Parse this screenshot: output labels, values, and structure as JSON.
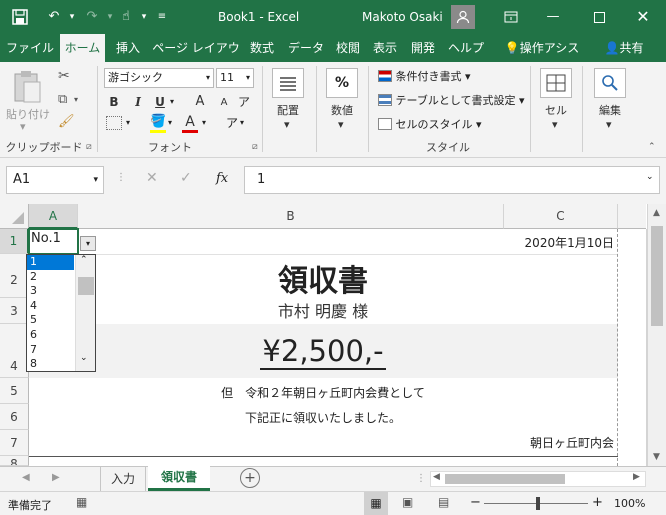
{
  "title_bar": {
    "doc_title": "Book1 - Excel",
    "user_name": "Makoto Osaki",
    "qat": {
      "save": "save-icon",
      "undo": "undo-icon",
      "redo": "redo-icon",
      "touch": "touch-icon",
      "customize": "customize-icon"
    }
  },
  "tabs": [
    "ファイル",
    "ホーム",
    "挿入",
    "ページ レイアウト",
    "数式",
    "データ",
    "校閲",
    "表示",
    "開発",
    "ヘルプ"
  ],
  "tell_me": "操作アシス",
  "share": "共有",
  "ribbon": {
    "clipboard": {
      "paste": "貼り付け",
      "label": "クリップボード"
    },
    "font": {
      "font_name": "游ゴシック",
      "font_size": "11",
      "bold": "B",
      "italic": "I",
      "underline": "U",
      "grow": "A",
      "shrink": "A",
      "font_color": "A",
      "label": "フォント"
    },
    "alignment": {
      "label": "配置"
    },
    "number": {
      "label": "数値",
      "percent": "%"
    },
    "styles": {
      "cond": "条件付き書式",
      "table": "テーブルとして書式設定",
      "cell_style": "セルのスタイル",
      "label": "スタイル"
    },
    "cells": {
      "label": "セル"
    },
    "editing": {
      "label": "編集"
    }
  },
  "formula_bar": {
    "name_box": "A1",
    "fx": "fx",
    "value": "1"
  },
  "columns": [
    "A",
    "B",
    "C"
  ],
  "rows": [
    "1",
    "2",
    "3",
    "4",
    "5",
    "6",
    "7",
    "8"
  ],
  "cells": {
    "a1": "No.1",
    "c1": "2020年1月10日",
    "b2": "領収書",
    "b3": "市村 明慶 様",
    "b4": "¥2,500,-",
    "b5": "但　令和２年朝日ヶ丘町内会費として",
    "b6": "下記正に領収いたしました。",
    "c7": "朝日ヶ丘町内会"
  },
  "dropdown": {
    "items": [
      "1",
      "2",
      "3",
      "4",
      "5",
      "6",
      "7",
      "8"
    ],
    "selected": "1"
  },
  "sheets": [
    "入力",
    "領収書"
  ],
  "active_sheet": "領収書",
  "status": {
    "ready": "準備完了",
    "zoom": "100%",
    "zoom_minus": "−",
    "zoom_plus": "+"
  },
  "colors": {
    "excel_green": "#217346",
    "ribbon_bg": "#f3f3f3",
    "selection": "#0078d7"
  }
}
